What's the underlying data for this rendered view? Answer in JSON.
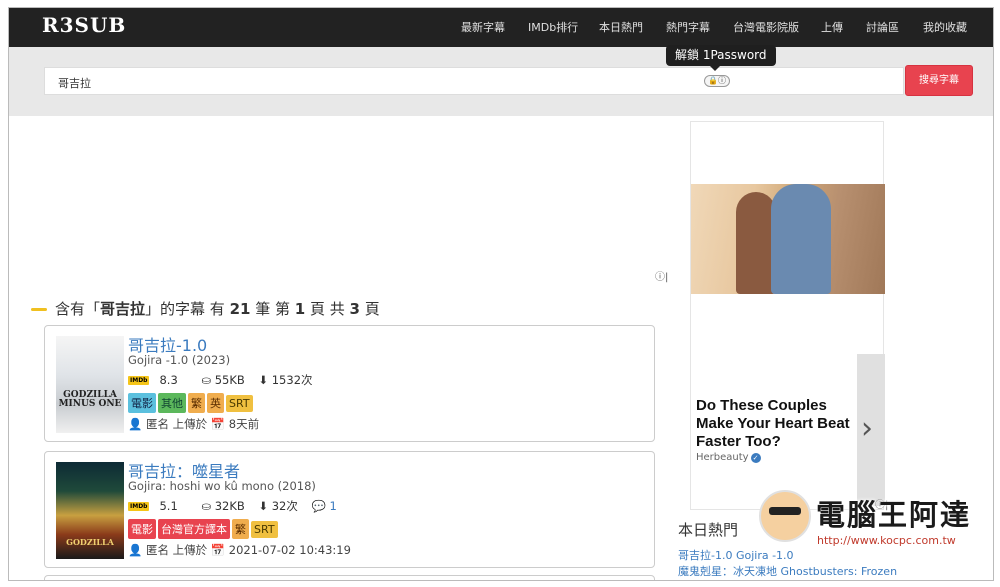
{
  "navbar": {
    "logo": "R3SUB",
    "items": [
      "最新字幕",
      "IMDb排行",
      "本日熱門",
      "熱門字幕",
      "台灣電影院版",
      "上傳",
      "討論區",
      "我的收藏"
    ]
  },
  "search": {
    "value": "哥吉拉",
    "button_label": "搜尋字幕",
    "pw_icon_text": "🔒ⓘ",
    "pw_tooltip": "解鎖 1Password"
  },
  "ad_badge": "ⓘ|",
  "results_heading": {
    "prefix": "含有「",
    "query": "哥吉拉",
    "mid": "」的字幕 有 ",
    "count": "21",
    "unit": " 筆 第 ",
    "page": "1",
    "page_sep": " 頁 共 ",
    "total_pages": "3",
    "suffix": " 頁"
  },
  "results": [
    {
      "title": "哥吉拉-1.0",
      "original": "Gojira -1.0 (2023)",
      "imdb_badge": "IMDb",
      "rating": "8.3",
      "size": "⛀ 55KB",
      "downloads": "⬇ 1532次",
      "comments": "",
      "tags": [
        "電影",
        "其他",
        "繁",
        "英",
        "SRT"
      ],
      "uploader": "👤 匿名 上傳於 📅 8天前",
      "poster_text": "GODZILLA MINUS ONE"
    },
    {
      "title": "哥吉拉：噬星者",
      "original": "Gojira: hoshi wo kû mono (2018)",
      "imdb_badge": "IMDb",
      "rating": "5.1",
      "size": "⛀ 32KB",
      "downloads": "⬇ 32次",
      "comments": "💬 1",
      "tags": [
        "電影",
        "台灣官方譯本",
        "繁",
        "SRT"
      ],
      "uploader": "👤 匿名 上傳於 📅 2021-07-02 10:43:19",
      "poster_text": "GODZILLA"
    }
  ],
  "sidebar_ad": {
    "headline": "Do These Couples Make Your Heart Beat Faster Too?",
    "source": "Herbeauty",
    "verified": "✓",
    "next_icon": "›"
  },
  "hot": {
    "title": "本日熱門",
    "items": [
      "哥吉拉-1.0 Gojira -1.0",
      "魔鬼剋星：冰天凍地 Ghostbusters: Frozen"
    ]
  },
  "watermark": {
    "text": "電腦王阿達",
    "url": "http://www.kocpc.com.tw"
  },
  "colors": {
    "navbar_bg": "#222222",
    "accent_red": "#e8434f",
    "link_blue": "#3b7bbf",
    "band_bg": "#e8e8e8"
  }
}
